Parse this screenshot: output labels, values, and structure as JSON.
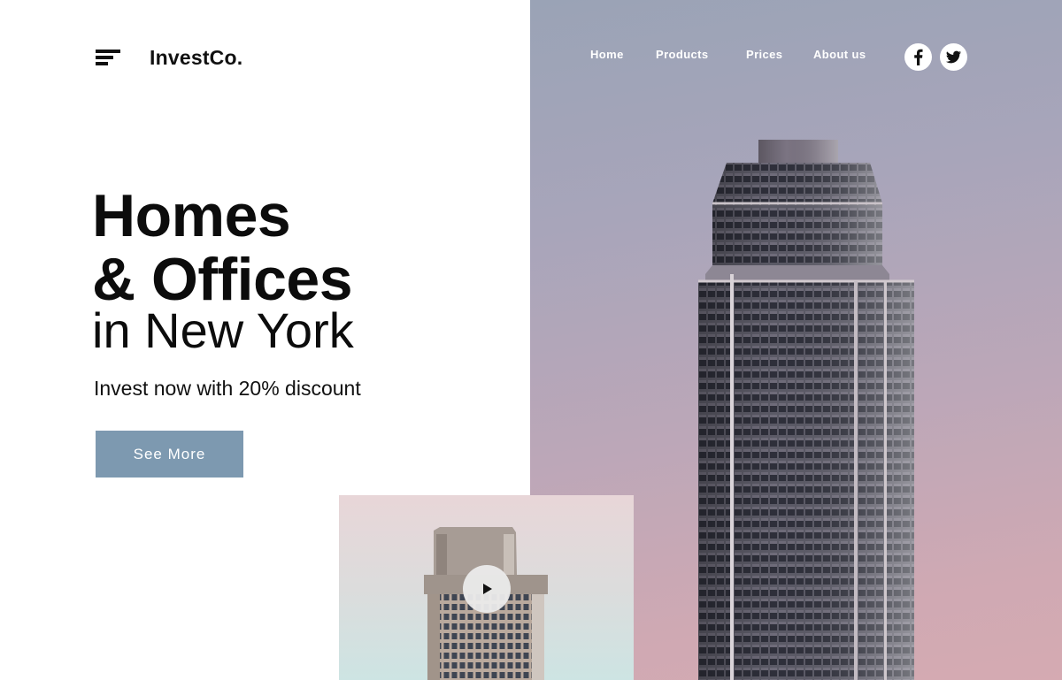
{
  "header": {
    "brand": "InvestCo.",
    "nav": [
      {
        "label": "Home"
      },
      {
        "label": "Products"
      },
      {
        "label": "Prices"
      },
      {
        "label": "About us"
      }
    ],
    "social": [
      {
        "icon": "facebook-icon",
        "glyph": "f"
      },
      {
        "icon": "twitter-icon"
      }
    ]
  },
  "hero": {
    "title_line1": "Homes",
    "title_line2": "& Offices",
    "title_line3": "in New York",
    "subtitle": "Invest now with 20% discount",
    "cta_label": "See More"
  },
  "colors": {
    "accent": "#7d99b0",
    "text": "#111111",
    "nav_text": "#ffffff"
  }
}
